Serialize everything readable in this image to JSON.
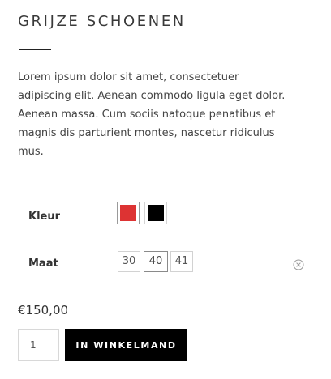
{
  "product": {
    "title": "GRIJZE SCHOENEN",
    "description": "Lorem ipsum dolor sit amet, consectetuer adipiscing elit. Aenean commodo ligula eget dolor. Aenean massa. Cum sociis natoque penatibus et magnis dis parturient montes, nascetur ridiculus mus."
  },
  "options": {
    "color": {
      "label": "Kleur",
      "swatches": [
        {
          "name": "red",
          "hex": "#dd3333",
          "selected": true
        },
        {
          "name": "black",
          "hex": "#000000",
          "selected": false
        }
      ]
    },
    "size": {
      "label": "Maat",
      "values": [
        "30",
        "40",
        "41"
      ],
      "selected": "40"
    },
    "reset_icon": "close-circle-icon"
  },
  "price": "€150,00",
  "cart": {
    "quantity": "1",
    "button_label": "IN WINKELMAND"
  },
  "colors": {
    "accent_red": "#dd3333",
    "button_bg": "#000000",
    "button_text": "#ffffff"
  }
}
